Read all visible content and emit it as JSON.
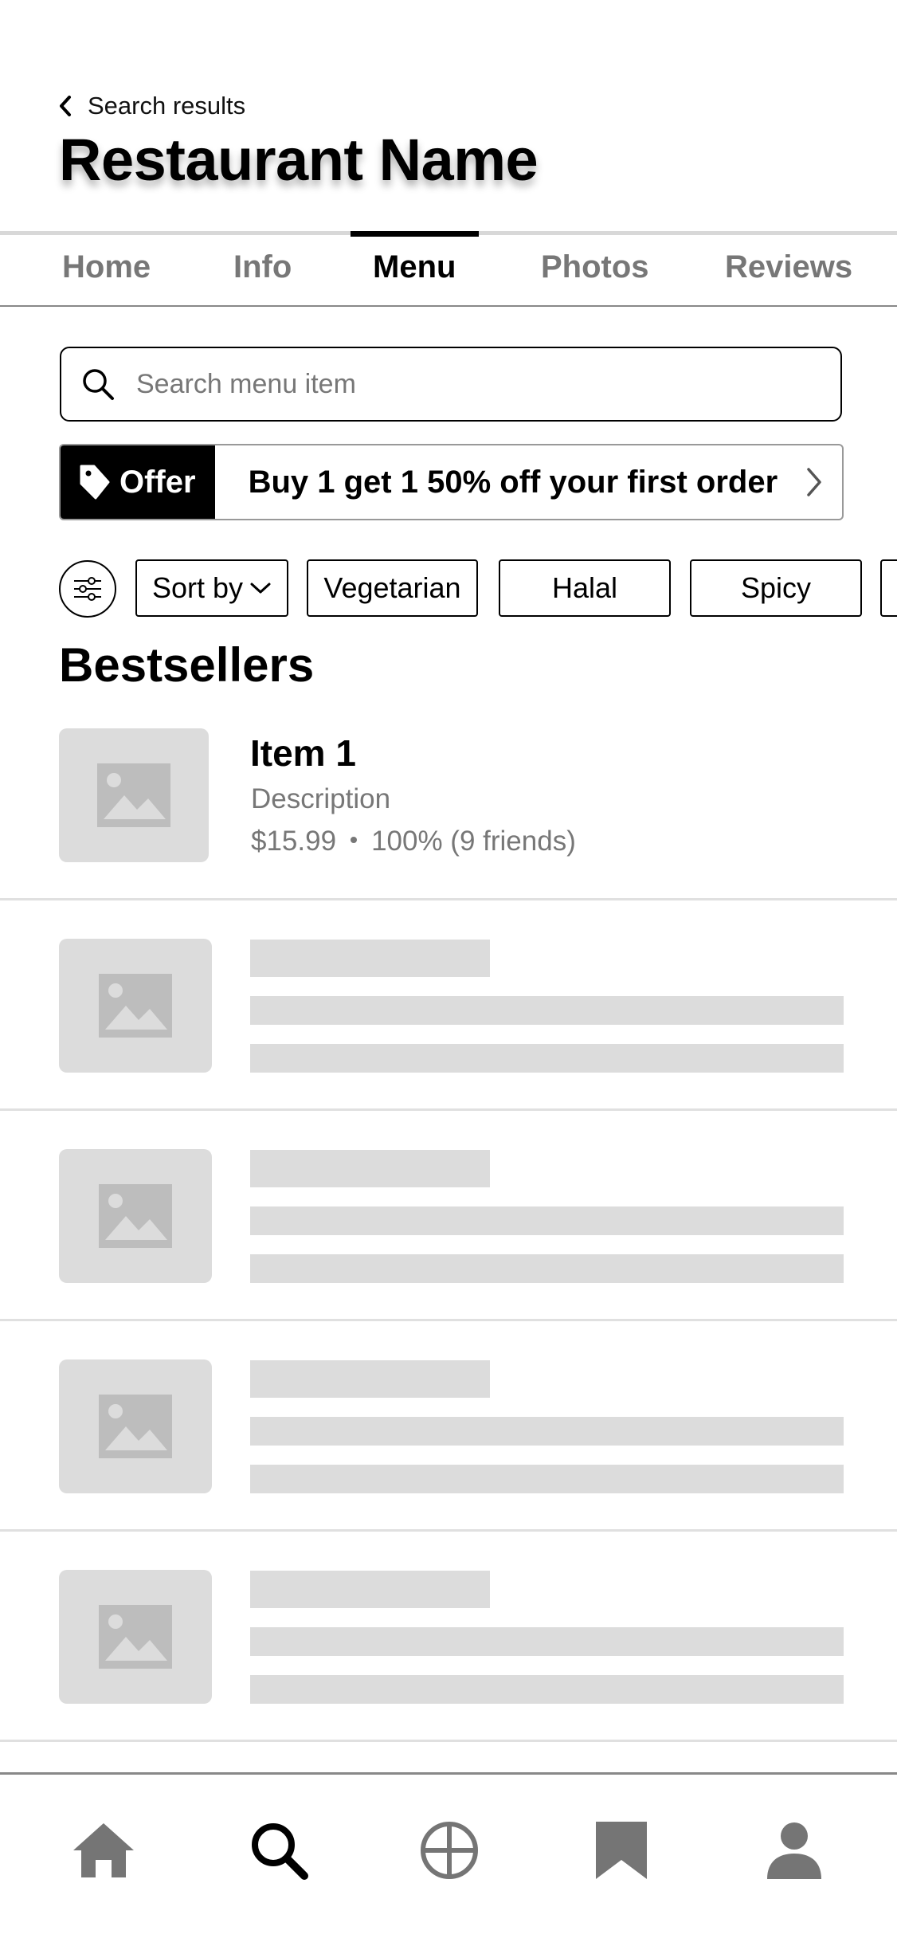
{
  "header": {
    "back_label": "Search results",
    "title": "Restaurant Name"
  },
  "tabs": [
    {
      "label": "Home",
      "active": false
    },
    {
      "label": "Info",
      "active": false
    },
    {
      "label": "Menu",
      "active": true
    },
    {
      "label": "Photos",
      "active": false
    },
    {
      "label": "Reviews",
      "active": false
    }
  ],
  "search": {
    "placeholder": "Search menu item",
    "value": ""
  },
  "offer": {
    "tag_label": "Offer",
    "text": "Buy 1 get 1 50% off your first order"
  },
  "filters": {
    "chips": [
      {
        "label": "Sort by"
      },
      {
        "label": "Vegetarian"
      },
      {
        "label": "Halal"
      },
      {
        "label": "Spicy"
      }
    ]
  },
  "bestsellers": {
    "title": "Bestsellers",
    "items": [
      {
        "name": "Item 1",
        "description": "Description",
        "price": "$15.99",
        "rating": "100% (9 friends)"
      }
    ],
    "placeholder_rows": 4
  },
  "bottom_nav": [
    {
      "icon": "home-icon",
      "active": false
    },
    {
      "icon": "search-icon",
      "active": true
    },
    {
      "icon": "explore-icon",
      "active": false
    },
    {
      "icon": "bookmark-icon",
      "active": false
    },
    {
      "icon": "profile-icon",
      "active": false
    }
  ],
  "colors": {
    "placeholder": "#dcdcdc",
    "muted_text": "#777777",
    "icon_inactive": "#757575",
    "offer_tag_bg": "#000000"
  }
}
